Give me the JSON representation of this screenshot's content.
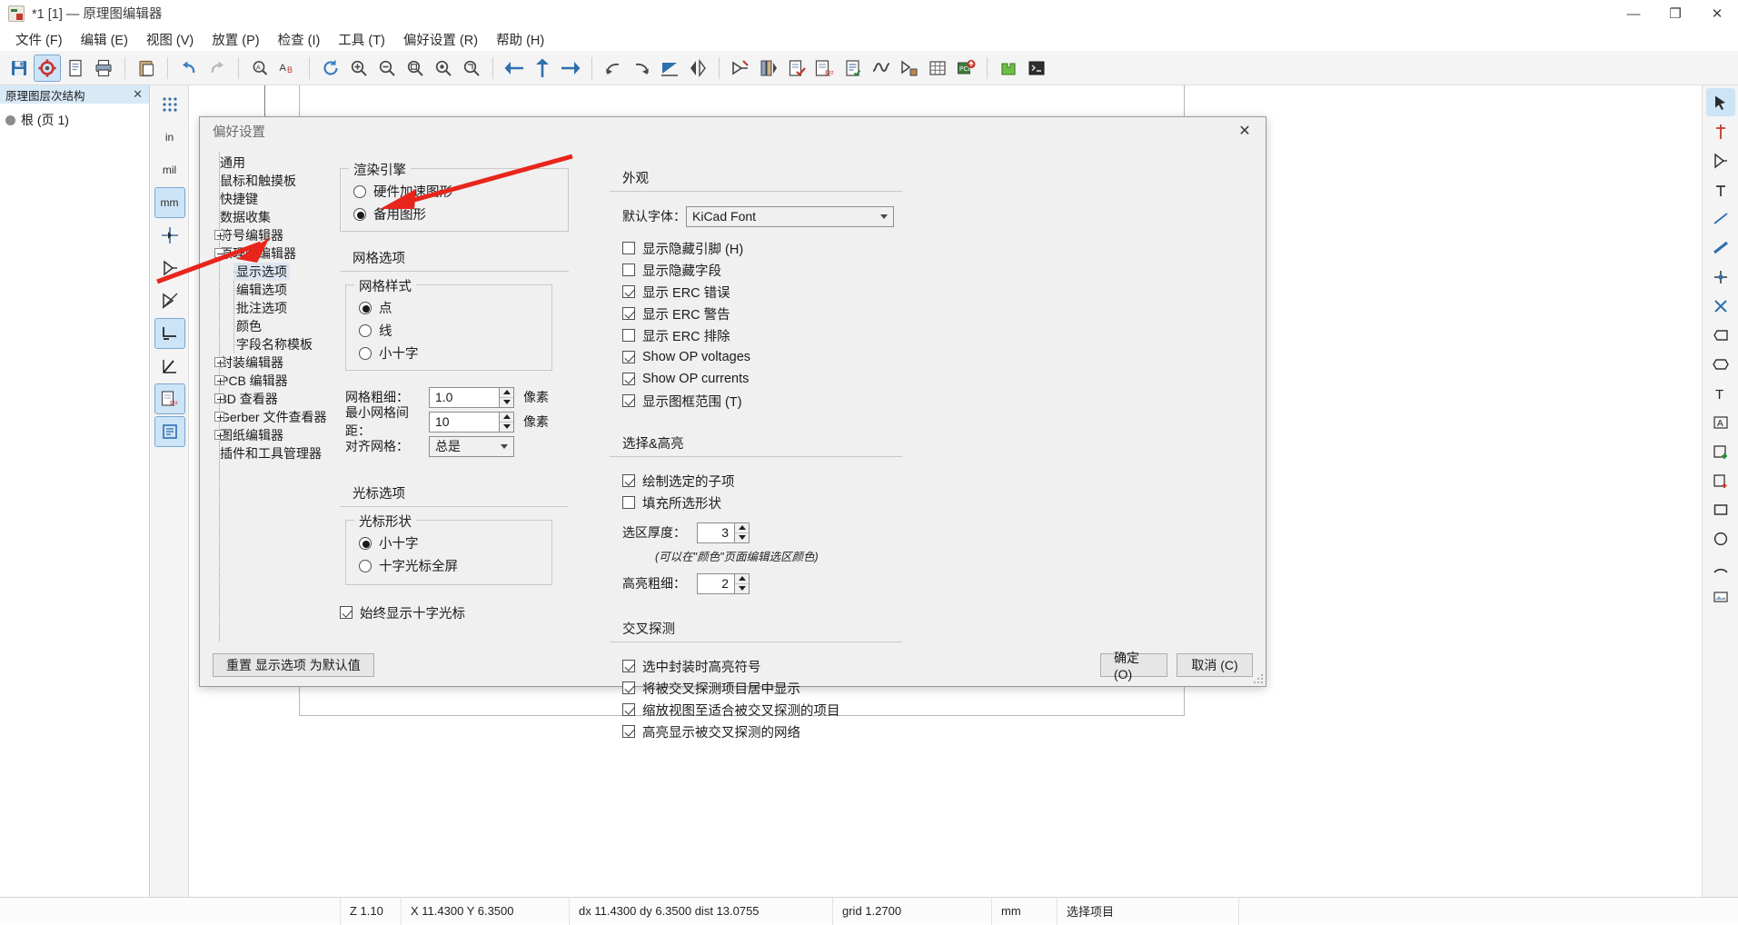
{
  "window": {
    "title": "*1 [1] — 原理图编辑器",
    "minimize": "—",
    "maximize": "❐",
    "close": "✕"
  },
  "menubar": [
    {
      "label": "文件 (F)"
    },
    {
      "label": "编辑 (E)"
    },
    {
      "label": "视图 (V)"
    },
    {
      "label": "放置 (P)"
    },
    {
      "label": "检查 (I)"
    },
    {
      "label": "工具 (T)"
    },
    {
      "label": "偏好设置 (R)"
    },
    {
      "label": "帮助 (H)"
    }
  ],
  "hierarchy_panel": {
    "title": "原理图层次结构",
    "close": "✕",
    "root_item": "根 (页 1)"
  },
  "left_strip": [
    {
      "label": "⠿",
      "name": "grid-toggle"
    },
    {
      "label": "in",
      "name": "unit-inch"
    },
    {
      "label": "mil",
      "name": "unit-mil"
    },
    {
      "label": "mm",
      "name": "unit-mm",
      "active": true
    },
    {
      "label": "✛",
      "name": "cursor-full-window"
    },
    {
      "label": "▷",
      "name": "hidden-pins"
    },
    {
      "label": "⊿",
      "name": "bus-entry-mode"
    },
    {
      "label": "⌐",
      "name": "h-v-lines",
      "active": true
    },
    {
      "label": "∠",
      "name": "any-angle-lines"
    },
    {
      "label": "R²",
      "name": "annotate-mode"
    },
    {
      "label": "▤",
      "name": "sheet-pins"
    }
  ],
  "status_bar": {
    "zoom": "Z 1.10",
    "coords": "X  11.4300  Y  6.3500",
    "deltas": "dx  11.4300  dy  6.3500  dist 13.0755",
    "grid": "grid 1.2700",
    "units": "mm",
    "mode": "选择项目"
  },
  "dialog": {
    "title": "偏好设置",
    "close": "✕",
    "tree": [
      {
        "label": "通用",
        "indent": 1,
        "expander": "none",
        "selected": false
      },
      {
        "label": "鼠标和触摸板",
        "indent": 1,
        "expander": "none",
        "selected": false
      },
      {
        "label": "快捷键",
        "indent": 1,
        "expander": "none",
        "selected": false
      },
      {
        "label": "数据收集",
        "indent": 1,
        "expander": "none",
        "selected": false
      },
      {
        "label": "符号编辑器",
        "indent": 1,
        "expander": "plus",
        "selected": false
      },
      {
        "label": "原理图编辑器",
        "indent": 1,
        "expander": "minus",
        "selected": false
      },
      {
        "label": "显示选项",
        "indent": 2,
        "expander": "none",
        "selected": true
      },
      {
        "label": "编辑选项",
        "indent": 2,
        "expander": "none",
        "selected": false
      },
      {
        "label": "批注选项",
        "indent": 2,
        "expander": "none",
        "selected": false
      },
      {
        "label": "颜色",
        "indent": 2,
        "expander": "none",
        "selected": false
      },
      {
        "label": "字段名称模板",
        "indent": 2,
        "expander": "none",
        "selected": false
      },
      {
        "label": "封装编辑器",
        "indent": 1,
        "expander": "plus",
        "selected": false
      },
      {
        "label": "PCB 编辑器",
        "indent": 1,
        "expander": "plus",
        "selected": false
      },
      {
        "label": "3D 查看器",
        "indent": 1,
        "expander": "plus",
        "selected": false
      },
      {
        "label": "Gerber 文件查看器",
        "indent": 1,
        "expander": "plus",
        "selected": false
      },
      {
        "label": "图纸编辑器",
        "indent": 1,
        "expander": "plus",
        "selected": false
      },
      {
        "label": "插件和工具管理器",
        "indent": 1,
        "expander": "none",
        "selected": false
      }
    ],
    "render_engine": {
      "title": "渲染引擎",
      "options": [
        {
          "label": "硬件加速图形",
          "selected": false
        },
        {
          "label": "备用图形",
          "selected": true
        }
      ]
    },
    "grid_options": {
      "title": "网格选项",
      "grid_style": {
        "title": "网格样式",
        "options": [
          {
            "label": "点",
            "selected": true
          },
          {
            "label": "线",
            "selected": false
          },
          {
            "label": "小十字",
            "selected": false
          }
        ]
      },
      "grid_thickness": {
        "label": "网格粗细：",
        "value": "1.0",
        "unit": "像素"
      },
      "min_grid_spacing": {
        "label": "最小网格间距：",
        "value": "10",
        "unit": "像素"
      },
      "snap_to_grid": {
        "label": "对齐网格：",
        "value": "总是"
      }
    },
    "cursor_options": {
      "title": "光标选项",
      "cursor_shape": {
        "title": "光标形状",
        "options": [
          {
            "label": "小十字",
            "selected": true
          },
          {
            "label": "十字光标全屏",
            "selected": false
          }
        ]
      },
      "always_show": {
        "label": "始终显示十字光标",
        "checked": true
      }
    },
    "appearance": {
      "title": "外观",
      "default_font": {
        "label": "默认字体：",
        "value": "KiCad Font"
      },
      "checks": [
        {
          "label": "显示隐藏引脚 (H)",
          "checked": false
        },
        {
          "label": "显示隐藏字段",
          "checked": false
        },
        {
          "label": "显示 ERC 错误",
          "checked": true
        },
        {
          "label": "显示 ERC 警告",
          "checked": true
        },
        {
          "label": "显示 ERC 排除",
          "checked": false
        },
        {
          "label": "Show OP voltages",
          "checked": true
        },
        {
          "label": "Show OP currents",
          "checked": true
        },
        {
          "label": "显示图框范围 (T)",
          "checked": true
        }
      ]
    },
    "selection_highlight": {
      "title": "选择&高亮",
      "checks": [
        {
          "label": "绘制选定的子项",
          "checked": true
        },
        {
          "label": "填充所选形状",
          "checked": false
        }
      ],
      "selection_thickness": {
        "label": "选区厚度：",
        "value": "3"
      },
      "hint": "(可以在\"颜色\"页面编辑选区颜色)",
      "highlight_thickness": {
        "label": "高亮粗细：",
        "value": "2"
      }
    },
    "cross_probing": {
      "title": "交叉探测",
      "checks": [
        {
          "label": "选中封装时高亮符号",
          "checked": true
        },
        {
          "label": "将被交叉探测项目居中显示",
          "checked": true
        },
        {
          "label": "缩放视图至适合被交叉探测的项目",
          "checked": true
        },
        {
          "label": "高亮显示被交叉探测的网络",
          "checked": true
        }
      ]
    },
    "footer": {
      "reset": "重置 显示选项 为默认值",
      "ok": "确定 (O)",
      "cancel": "取消 (C)"
    }
  },
  "annotations": {
    "arrow_color": "#e8251c",
    "arrow1_target": "备用图形",
    "arrow2_target": "显示选项"
  }
}
